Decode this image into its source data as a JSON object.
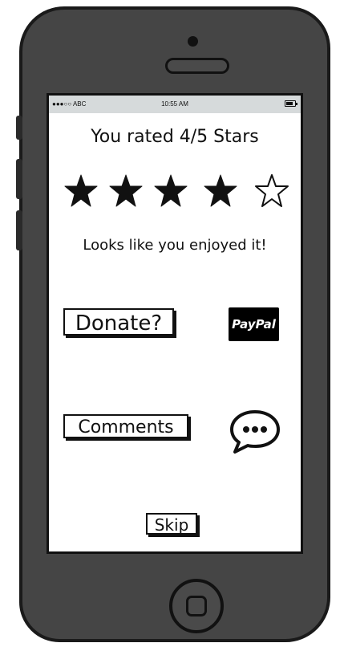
{
  "status_bar": {
    "carrier": "●●●○○ ABC",
    "time": "10:55 AM",
    "battery_icon": "battery-icon"
  },
  "rating": {
    "title": "You rated 4/5 Stars",
    "value": 4,
    "max": 5,
    "star_icons": [
      "star-filled-icon",
      "star-filled-icon",
      "star-filled-icon",
      "star-filled-icon",
      "star-empty-icon"
    ]
  },
  "message": "Looks like you enjoyed it!",
  "actions": {
    "donate_label": "Donate?",
    "paypal_label": "PayPal",
    "comments_label": "Comments",
    "comment_icon": "speech-bubble-icon",
    "skip_label": "Skip"
  },
  "colors": {
    "phone_body": "#454545",
    "phone_outline": "#1a1a1a",
    "status_bar_bg": "#d6dadb",
    "paypal_bg": "#000000",
    "ink": "#111111"
  }
}
